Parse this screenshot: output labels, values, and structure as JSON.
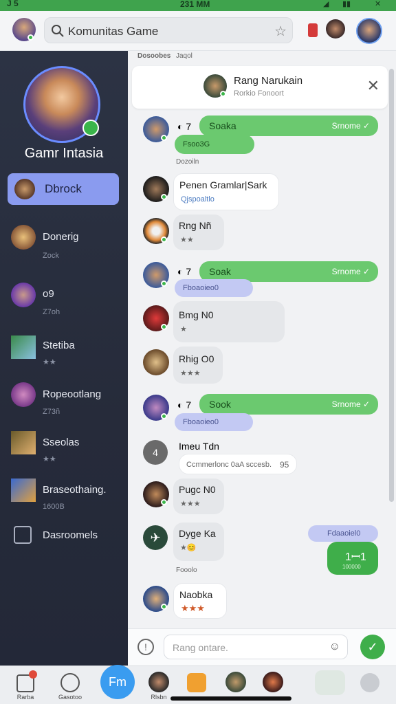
{
  "status_bar": {
    "left": "J 5",
    "time": "231 MM"
  },
  "search": {
    "placeholder": "Komunitas Game"
  },
  "sidebar": {
    "profile_name": "Gamr Intasia",
    "selected_item": "Dbrock",
    "items": [
      {
        "label": "Donerig",
        "sub": "Zock"
      },
      {
        "label": "o9",
        "sub": "Z7oh"
      },
      {
        "label": "Stetiba",
        "sub": "★★"
      },
      {
        "label": "Ropeootlang",
        "sub": "Z73ñ"
      },
      {
        "label": "Sseolas",
        "sub": "★★"
      },
      {
        "label": "Braseothaing.",
        "sub": "1600B"
      },
      {
        "label": "Dasroomels",
        "sub": ""
      }
    ]
  },
  "chat": {
    "tabs": [
      "Dosoobes",
      "Jaqol"
    ],
    "header": {
      "title": "Rang Narukain",
      "subtitle": "Rorkio Fonoort"
    },
    "messages": [
      {
        "text": "Soaka",
        "meta": "Srnome ✓",
        "tag": "Fsoo3G",
        "under": "Dozoiln"
      },
      {
        "text": "Penen Gramlar|Sark",
        "tag": "Qjspoaltlo"
      },
      {
        "text": "Rng Nñ",
        "sub": "★★"
      },
      {
        "text": "Soak",
        "meta": "Srnome ✓",
        "tag": "Fboaoieo0"
      },
      {
        "text": "Bmg N0",
        "sub": "★"
      },
      {
        "text": "Rhig O0",
        "sub": "★★★"
      },
      {
        "text": "Sook",
        "meta": "Srnome ✓",
        "tag": "Fboaoieo0"
      },
      {
        "text": "Imeu Tdn",
        "sub": "Ccmmerlonc 0aA sccesb.",
        "extra": "95"
      },
      {
        "text": "Pugc N0",
        "sub": "★★★"
      },
      {
        "text": "Dyge Ka",
        "sub": "★😊",
        "right_tag": "Fdaaoiel0",
        "right_main": "1ꟷ1",
        "right_sub": "100000",
        "under": "Fooolo"
      },
      {
        "text": "Naobka",
        "sub": "★★★"
      }
    ],
    "composer_placeholder": "Rang ontare."
  },
  "bottom_nav": {
    "items": [
      "Rarba",
      "Gasotoo"
    ],
    "fab": "Fm",
    "avatar_label": "Rlsbn"
  },
  "colors": {
    "accent_green": "#6bc96f",
    "sidebar_bg": "#2c3344",
    "selected": "#8a9bef"
  }
}
